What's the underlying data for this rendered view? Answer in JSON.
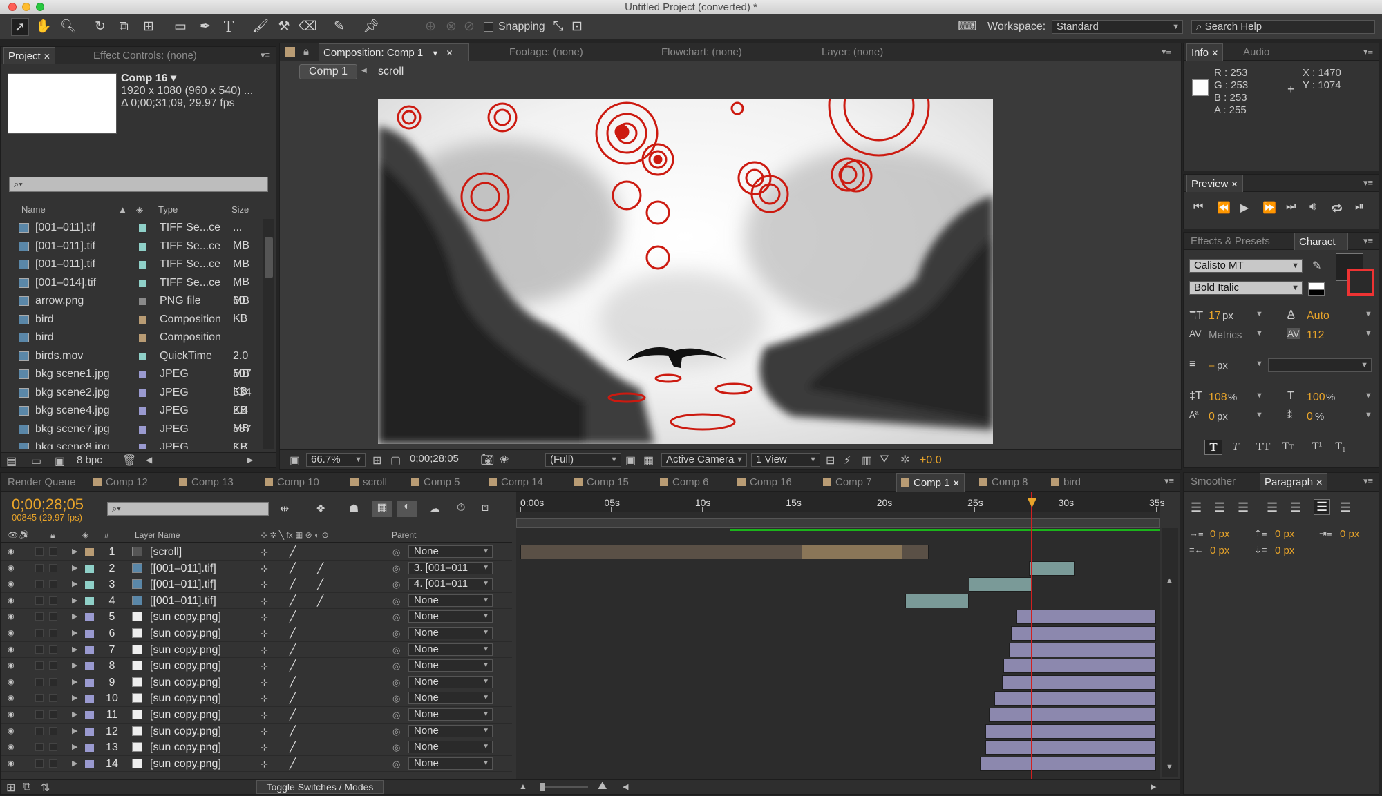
{
  "window": {
    "title": "Untitled Project (converted) *"
  },
  "toolbar": {
    "snapping_label": "Snapping",
    "workspace_label": "Workspace:",
    "workspace_value": "Standard",
    "search_placeholder": "Search Help"
  },
  "project_panel": {
    "tab_project": "Project",
    "tab_effect_controls": "Effect Controls: (none)",
    "comp_name": "Comp 16 ▾",
    "comp_res": "1920 x 1080  (960 x 540) ...",
    "comp_duration": "Δ 0;00;31;09, 29.97 fps",
    "columns": {
      "name": "Name",
      "type": "Type",
      "size": "Size"
    },
    "items": [
      {
        "name": "[001–011].tif",
        "type": "TIFF Se...ce",
        "size": "... MB",
        "icon": "tiff-icon",
        "color": "#8fd0c8"
      },
      {
        "name": "[001–011].tif",
        "type": "TIFF Se...ce",
        "size": "... MB",
        "icon": "tiff-icon",
        "color": "#8fd0c8"
      },
      {
        "name": "[001–011].tif",
        "type": "TIFF Se...ce",
        "size": "... MB",
        "icon": "tiff-icon",
        "color": "#8fd0c8"
      },
      {
        "name": "[001–014].tif",
        "type": "TIFF Se...ce",
        "size": "... MB",
        "icon": "tiff-icon",
        "color": "#8fd0c8"
      },
      {
        "name": "arrow.png",
        "type": "PNG file",
        "size": "60 KB",
        "icon": "png-icon",
        "color": "#8a8a8a"
      },
      {
        "name": "bird",
        "type": "Composition",
        "size": "",
        "icon": "comp-icon",
        "color": "#b99c74"
      },
      {
        "name": "bird",
        "type": "Composition",
        "size": "",
        "icon": "comp-icon",
        "color": "#b99c74"
      },
      {
        "name": "birds.mov",
        "type": "QuickTime",
        "size": "2.0 MB",
        "icon": "movie-icon",
        "color": "#8fd0c8"
      },
      {
        "name": "bkg scene1.jpg",
        "type": "JPEG",
        "size": "507 KB",
        "icon": "jpeg-icon",
        "color": "#9a9ad0"
      },
      {
        "name": "bkg scene2.jpg",
        "type": "JPEG",
        "size": "534 KB",
        "icon": "jpeg-icon",
        "color": "#9a9ad0"
      },
      {
        "name": "bkg scene4.jpg",
        "type": "JPEG",
        "size": "2.4 MB",
        "icon": "jpeg-icon",
        "color": "#9a9ad0"
      },
      {
        "name": "bkg scene7.jpg",
        "type": "JPEG",
        "size": "587 KB",
        "icon": "jpeg-icon",
        "color": "#9a9ad0"
      },
      {
        "name": "bkg scene8.jpg",
        "type": "JPEG",
        "size": "1.7 MB",
        "icon": "jpeg-icon",
        "color": "#9a9ad0"
      }
    ],
    "bpc": "8 bpc"
  },
  "comp_panel": {
    "tab_comp": "Composition: Comp 1",
    "tab_footage": "Footage: (none)",
    "tab_flowchart": "Flowchart: (none)",
    "tab_layer": "Layer: (none)",
    "breadcrumb_comp": "Comp 1",
    "breadcrumb_scroll": "scroll",
    "zoom": "66.7%",
    "timecode": "0;00;28;05",
    "resolution": "(Full)",
    "camera": "Active Camera",
    "views": "1 View",
    "exposure": "+0.0"
  },
  "info_panel": {
    "tab_info": "Info",
    "tab_audio": "Audio",
    "r": "R : 253",
    "g": "G : 253",
    "b": "B : 253",
    "a": "A : 255",
    "x": "X : 1470",
    "y": "Y : 1074"
  },
  "preview_panel": {
    "tab": "Preview"
  },
  "character_panel": {
    "tab_effects": "Effects & Presets",
    "tab_character": "Charact",
    "font": "Calisto MT",
    "style": "Bold Italic",
    "size": "17",
    "size_unit": "px",
    "leading": "Auto",
    "kerning": "Metrics",
    "tracking": "112",
    "stroke_width": "–",
    "stroke_unit": "px",
    "vscale": "108",
    "hscale": "100",
    "pct": "%",
    "baseline": "0",
    "baseline_unit": "px",
    "tsume": "0",
    "tsume_unit": "%"
  },
  "paragraph_panel": {
    "tab_smoother": "Smoother",
    "tab_paragraph": "Paragraph",
    "indent_values": [
      "0 px",
      "0 px",
      "0 px",
      "0 px",
      "0 px"
    ]
  },
  "timeline": {
    "tabs": [
      "Render Queue",
      "Comp 12",
      "Comp 13",
      "Comp 10",
      "scroll",
      "Comp 5",
      "Comp 14",
      "Comp 15",
      "Comp 6",
      "Comp 16",
      "Comp 7",
      "Comp 1",
      "Comp 8",
      "bird"
    ],
    "active_tab": "Comp 1",
    "timecode": "0;00;28;05",
    "frame_info": "00845 (29.97 fps)",
    "col_layer_name": "Layer Name",
    "col_parent": "Parent",
    "ruler_labels": [
      "0:00s",
      "05s",
      "10s",
      "15s",
      "20s",
      "25s",
      "30s",
      "35s"
    ],
    "toggle_label": "Toggle Switches / Modes",
    "current_time_sec": 28.17,
    "duration_sec": 35,
    "layers": [
      {
        "num": "1",
        "name": "[scroll]",
        "parent": "None",
        "label_color": "#b99c74",
        "bar_color": "#5a5046",
        "start": 0,
        "end": 22.5,
        "highlight": [
          15.5,
          21
        ],
        "icon": "comp-layer-icon"
      },
      {
        "num": "2",
        "name": "[[001–011].tif]",
        "parent": "3. [001–011",
        "label_color": "#8fd0c8",
        "bar_color": "#7a9a98",
        "start": 28.0,
        "end": 30.5,
        "icon": "tiff-layer-icon"
      },
      {
        "num": "3",
        "name": "[[001–011].tif]",
        "parent": "4. [001–011",
        "label_color": "#8fd0c8",
        "bar_color": "#7a9a98",
        "start": 24.7,
        "end": 28.2,
        "icon": "tiff-layer-icon"
      },
      {
        "num": "4",
        "name": "[[001–011].tif]",
        "parent": "None",
        "label_color": "#8fd0c8",
        "bar_color": "#7a9a98",
        "start": 21.2,
        "end": 24.7,
        "icon": "tiff-layer-icon"
      },
      {
        "num": "5",
        "name": "[sun copy.png]",
        "parent": "None",
        "label_color": "#9a9ad0",
        "bar_color": "#8c88ae",
        "start": 27.3,
        "end": 35,
        "icon": "png-layer-icon"
      },
      {
        "num": "6",
        "name": "[sun copy.png]",
        "parent": "None",
        "label_color": "#9a9ad0",
        "bar_color": "#8c88ae",
        "start": 27.0,
        "end": 35,
        "icon": "png-layer-icon"
      },
      {
        "num": "7",
        "name": "[sun copy.png]",
        "parent": "None",
        "label_color": "#9a9ad0",
        "bar_color": "#8c88ae",
        "start": 26.9,
        "end": 35,
        "icon": "png-layer-icon"
      },
      {
        "num": "8",
        "name": "[sun copy.png]",
        "parent": "None",
        "label_color": "#9a9ad0",
        "bar_color": "#8c88ae",
        "start": 26.6,
        "end": 35,
        "icon": "png-layer-icon"
      },
      {
        "num": "9",
        "name": "[sun copy.png]",
        "parent": "None",
        "label_color": "#9a9ad0",
        "bar_color": "#8c88ae",
        "start": 26.5,
        "end": 35,
        "icon": "png-layer-icon"
      },
      {
        "num": "10",
        "name": "[sun copy.png]",
        "parent": "None",
        "label_color": "#9a9ad0",
        "bar_color": "#8c88ae",
        "start": 26.1,
        "end": 35,
        "icon": "png-layer-icon"
      },
      {
        "num": "11",
        "name": "[sun copy.png]",
        "parent": "None",
        "label_color": "#9a9ad0",
        "bar_color": "#8c88ae",
        "start": 25.8,
        "end": 35,
        "icon": "png-layer-icon"
      },
      {
        "num": "12",
        "name": "[sun copy.png]",
        "parent": "None",
        "label_color": "#9a9ad0",
        "bar_color": "#8c88ae",
        "start": 25.6,
        "end": 35,
        "icon": "png-layer-icon"
      },
      {
        "num": "13",
        "name": "[sun copy.png]",
        "parent": "None",
        "label_color": "#9a9ad0",
        "bar_color": "#8c88ae",
        "start": 25.6,
        "end": 35,
        "icon": "png-layer-icon"
      },
      {
        "num": "14",
        "name": "[sun copy.png]",
        "parent": "None",
        "label_color": "#9a9ad0",
        "bar_color": "#8c88ae",
        "start": 25.3,
        "end": 35,
        "icon": "png-layer-icon"
      }
    ]
  },
  "colors": {
    "accent": "#e8a42a",
    "playhead": "#d02020",
    "sun_red": "#cc1a10",
    "panel_bg": "#333333"
  }
}
